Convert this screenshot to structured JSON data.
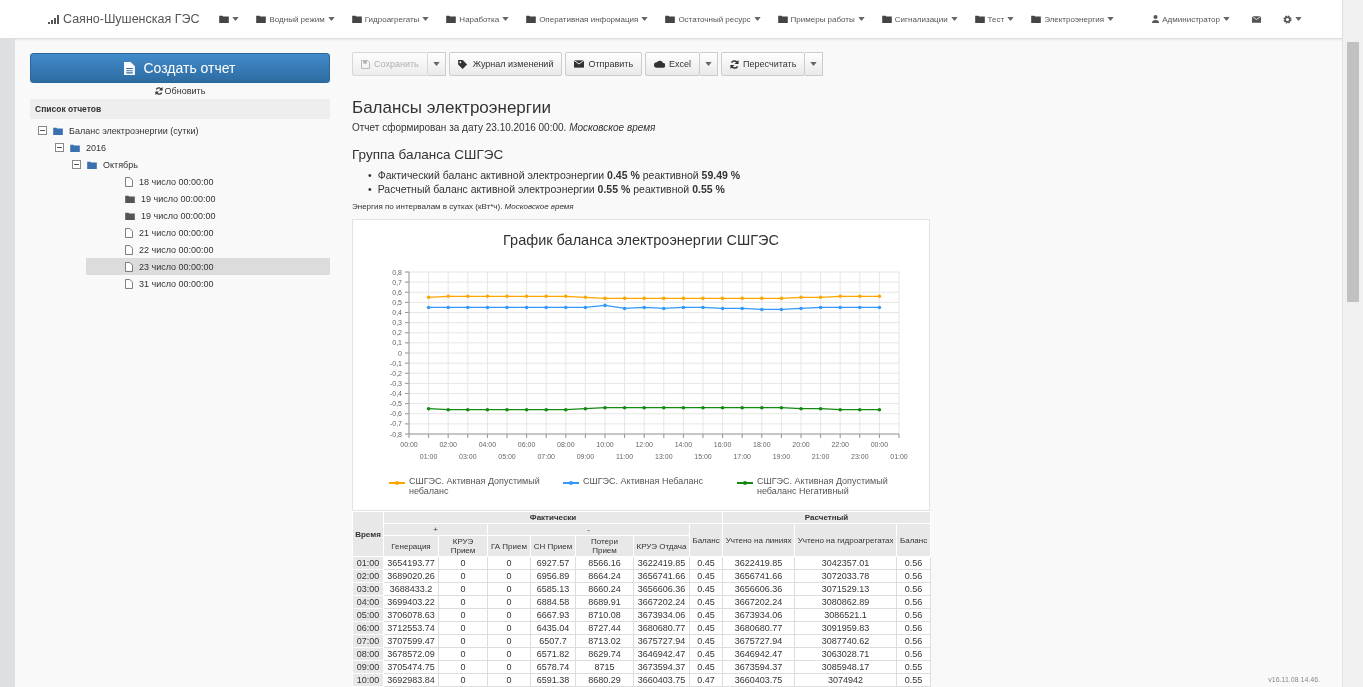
{
  "navbar": {
    "brand": "Саяно-Шушенская ГЭС",
    "menus": [
      {
        "kind": "icon-only"
      },
      {
        "kind": "labeled",
        "label": "Водный режим"
      },
      {
        "kind": "labeled",
        "label": "Гидроагрегаты"
      },
      {
        "kind": "labeled",
        "label": "Наработка"
      },
      {
        "kind": "labeled",
        "label": "Оперативная информация"
      },
      {
        "kind": "labeled",
        "label": "Остаточный ресурс"
      },
      {
        "kind": "labeled",
        "label": "Примеры работы"
      },
      {
        "kind": "labeled",
        "label": "Сигнализации"
      },
      {
        "kind": "labeled",
        "label": "Тест"
      },
      {
        "kind": "labeled",
        "label": "Электроэнергия"
      }
    ],
    "user": "Администратор"
  },
  "sidebar": {
    "create_button": "Создать отчет",
    "refresh": "Обновить",
    "list_title": "Список отчетов",
    "tree": [
      {
        "label": "Баланс электроэнергии (сутки)",
        "kind": "group",
        "expanded": true,
        "children": [
          {
            "label": "2016",
            "kind": "group",
            "expanded": true,
            "children": [
              {
                "label": "Октябрь",
                "kind": "group",
                "expanded": true,
                "children": [
                  {
                    "label": "18 число 00:00:00",
                    "kind": "file",
                    "selected": false
                  },
                  {
                    "label": "19 число 00:00:00",
                    "kind": "folder",
                    "selected": false
                  },
                  {
                    "label": "19 число 00:00:00",
                    "kind": "folder",
                    "selected": false
                  },
                  {
                    "label": "21 число 00:00:00",
                    "kind": "file",
                    "selected": false
                  },
                  {
                    "label": "22 число 00:00:00",
                    "kind": "file",
                    "selected": false
                  },
                  {
                    "label": "23 число 00:00:00",
                    "kind": "file",
                    "selected": true
                  },
                  {
                    "label": "31 число 00:00:00",
                    "kind": "file",
                    "selected": false
                  }
                ]
              }
            ]
          }
        ]
      }
    ]
  },
  "toolbar": [
    {
      "label": "Сохранить",
      "disabled": true,
      "split": true
    },
    {
      "label": "Журнал изменений",
      "disabled": false,
      "split": false
    },
    {
      "label": "Отправить",
      "disabled": false,
      "split": false
    },
    {
      "label": "Excel",
      "disabled": false,
      "split": true
    },
    {
      "label": "Пересчитать",
      "disabled": false,
      "split": true
    }
  ],
  "report": {
    "title": "Балансы электроэнергии",
    "subtitle": "Отчет сформирован за дату 23.10.2016 00:00. *Московское время*",
    "group_title": "Группа баланса СШГЭС",
    "bullets": [
      {
        "marker": "•",
        "text": "Фактический баланс активной электроэнергии **0.45 %** реактивной **59.49 %**"
      },
      {
        "marker": "•",
        "text": "Расчетный баланс активной электроэнергии **0.55 %** реактивной **0.55 %**"
      }
    ],
    "note": "Энергия по интервалам в сутках (кВт*ч). *Московское время*",
    "chart_data": {
      "type": "line",
      "title": "График баланса электроэнергии СШГЭС",
      "grid": true,
      "legend": true,
      "categories": [
        "00:00",
        "01:00",
        "02:00",
        "03:00",
        "04:00",
        "05:00",
        "06:00",
        "07:00",
        "08:00",
        "09:00",
        "10:00",
        "11:00",
        "12:00",
        "13:00",
        "14:00",
        "15:00",
        "16:00",
        "17:00",
        "18:00",
        "19:00",
        "20:00",
        "21:00",
        "22:00",
        "23:00",
        "00:00",
        "01:00"
      ],
      "ylim": [
        -0.8,
        0.8
      ],
      "yticks": [
        {
          "value": 0.8,
          "label": "0,8"
        },
        {
          "value": 0.7,
          "label": "0,7"
        },
        {
          "value": 0.6,
          "label": "0,6"
        },
        {
          "value": 0.5,
          "label": "0,5"
        },
        {
          "value": 0.4,
          "label": "0,4"
        },
        {
          "value": 0.3,
          "label": "0,3"
        },
        {
          "value": 0.2,
          "label": "0,2"
        },
        {
          "value": 0.1,
          "label": "0,1"
        },
        {
          "value": 0,
          "label": "0"
        },
        {
          "value": -0.1,
          "label": "-0,1"
        },
        {
          "value": -0.2,
          "label": "-0,2"
        },
        {
          "value": -0.3,
          "label": "-0,3"
        },
        {
          "value": -0.4,
          "label": "-0,4"
        },
        {
          "value": -0.5,
          "label": "-0,5"
        },
        {
          "value": -0.6,
          "label": "-0,6"
        },
        {
          "value": -0.7,
          "label": "-0,7"
        },
        {
          "value": -0.8,
          "label": "-0,8"
        }
      ],
      "series": [
        {
          "name": "СШГЭС. Активная Допустимый небаланс",
          "color": "#ffa500",
          "values": [
            null,
            0.55,
            0.56,
            0.56,
            0.56,
            0.56,
            0.56,
            0.56,
            0.56,
            0.55,
            0.54,
            0.54,
            0.54,
            0.54,
            0.54,
            0.54,
            0.54,
            0.54,
            0.54,
            0.54,
            0.55,
            0.55,
            0.56,
            0.56,
            0.56,
            null
          ]
        },
        {
          "name": "СШГЭС. Активная Небаланс",
          "color": "#3399ff",
          "values": [
            null,
            0.45,
            0.45,
            0.45,
            0.45,
            0.45,
            0.45,
            0.45,
            0.45,
            0.45,
            0.47,
            0.44,
            0.45,
            0.44,
            0.45,
            0.45,
            0.44,
            0.44,
            0.43,
            0.43,
            0.44,
            0.45,
            0.45,
            0.45,
            0.45,
            null
          ]
        },
        {
          "name": "СШГЭС. Активная Допустимый небаланс Негативный",
          "color": "#138a13",
          "values": [
            null,
            -0.55,
            -0.56,
            -0.56,
            -0.56,
            -0.56,
            -0.56,
            -0.56,
            -0.56,
            -0.55,
            -0.54,
            -0.54,
            -0.54,
            -0.54,
            -0.54,
            -0.54,
            -0.54,
            -0.54,
            -0.54,
            -0.54,
            -0.55,
            -0.55,
            -0.56,
            -0.56,
            -0.56,
            null
          ]
        }
      ]
    },
    "table": {
      "header_rows": [
        [
          {
            "text": "Время",
            "rowspan": 3
          },
          {
            "text": "Фактически",
            "colspan": 7
          },
          {
            "text": "Расчетный",
            "colspan": 3
          }
        ],
        [
          {
            "text": "+",
            "colspan": 2
          },
          {
            "text": "-",
            "colspan": 4
          },
          {
            "text": "Баланс",
            "rowspan": 2
          },
          {
            "text": "Учтено на линиях",
            "rowspan": 2
          },
          {
            "text": "Учтено на гидроагрегатах",
            "rowspan": 2
          },
          {
            "text": "Баланс",
            "rowspan": 2
          }
        ],
        [
          {
            "text": "Генерация"
          },
          {
            "text": "КРУЭ Прием"
          },
          {
            "text": "ГА Прием"
          },
          {
            "text": "СН Прием"
          },
          {
            "text": "Потери Прием"
          },
          {
            "text": "КРУЭ Отдача"
          }
        ]
      ],
      "rows": [
        [
          "01:00",
          "3654193.77",
          "0",
          "0",
          "6927.57",
          "8566.16",
          "3622419.85",
          "0.45",
          "3622419.85",
          "3042357.01",
          "0.56"
        ],
        [
          "02:00",
          "3689020.26",
          "0",
          "0",
          "6956.89",
          "8664.24",
          "3656741.66",
          "0.45",
          "3656741.66",
          "3072033.78",
          "0.56"
        ],
        [
          "03:00",
          "3688433.2",
          "0",
          "0",
          "6585.13",
          "8660.24",
          "3656606.36",
          "0.45",
          "3656606.36",
          "3071529.13",
          "0.56"
        ],
        [
          "04:00",
          "3699403.22",
          "0",
          "0",
          "6884.58",
          "8689.91",
          "3667202.24",
          "0.45",
          "3667202.24",
          "3080862.89",
          "0.56"
        ],
        [
          "05:00",
          "3706078.63",
          "0",
          "0",
          "6667.93",
          "8710.08",
          "3673934.06",
          "0.45",
          "3673934.06",
          "3086521.1",
          "0.56"
        ],
        [
          "06:00",
          "3712553.74",
          "0",
          "0",
          "6435.04",
          "8727.44",
          "3680680.77",
          "0.45",
          "3680680.77",
          "3091959.83",
          "0.56"
        ],
        [
          "07:00",
          "3707599.47",
          "0",
          "0",
          "6507.7",
          "8713.02",
          "3675727.94",
          "0.45",
          "3675727.94",
          "3087740.62",
          "0.56"
        ],
        [
          "08:00",
          "3678572.09",
          "0",
          "0",
          "6571.82",
          "8629.74",
          "3646942.47",
          "0.45",
          "3646942.47",
          "3063028.71",
          "0.56"
        ],
        [
          "09:00",
          "3705474.75",
          "0",
          "0",
          "6578.74",
          "8715",
          "3673594.37",
          "0.45",
          "3673594.37",
          "3085948.17",
          "0.55"
        ],
        [
          "10:00",
          "3692983.84",
          "0",
          "0",
          "6591.38",
          "8680.29",
          "3660403.75",
          "0.47",
          "3660403.75",
          "3074942",
          "0.55"
        ]
      ]
    }
  },
  "version": "v16.11.08 14.46."
}
